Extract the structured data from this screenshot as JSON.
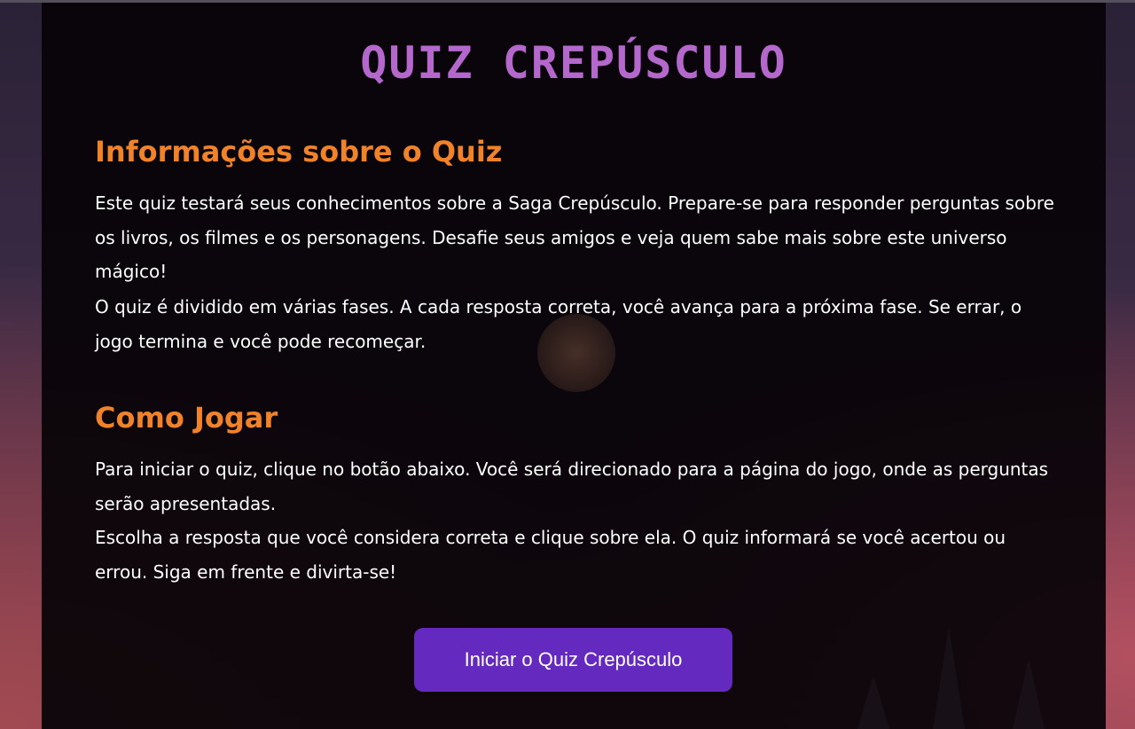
{
  "page": {
    "title": "QUIZ CREPÚSCULO"
  },
  "info": {
    "heading": "Informações sobre o Quiz",
    "paragraph_1": "Este quiz testará seus conhecimentos sobre a Saga Crepúsculo. Prepare-se para responder perguntas sobre os livros, os filmes e os personagens. Desafie seus amigos e veja quem sabe mais sobre este universo mágico!",
    "paragraph_2": "O quiz é dividido em várias fases. A cada resposta correta, você avança para a próxima fase. Se errar, o jogo termina e você pode recomeçar."
  },
  "how_to_play": {
    "heading": "Como Jogar",
    "paragraph_1": "Para iniciar o quiz, clique no botão abaixo. Você será direcionado para a página do jogo, onde as perguntas serão apresentadas.",
    "paragraph_2": "Escolha a resposta que você considera correta e clique sobre ela. O quiz informará se você acertou ou errou. Siga em frente e divirta-se!"
  },
  "start_button": {
    "label": "Iniciar o Quiz Crepúsculo"
  },
  "colors": {
    "title": "#b468cc",
    "heading": "#f0822a",
    "button": "#6429be",
    "panel": "#060308"
  }
}
